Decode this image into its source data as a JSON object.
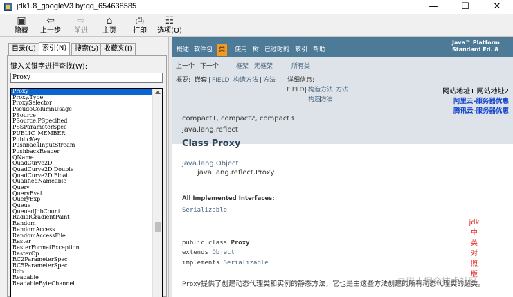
{
  "window": {
    "title": "jdk1.8_googleV3 by:qq_654638585",
    "minimize": "—",
    "maximize": "☐",
    "close": "✕"
  },
  "toolbar": {
    "items": [
      {
        "label": "隐藏",
        "icon": "hide-icon",
        "glyph": "▣",
        "enabled": true
      },
      {
        "label": "上一步",
        "icon": "back-arrow-icon",
        "glyph": "⇦",
        "enabled": true
      },
      {
        "label": "前进",
        "icon": "forward-arrow-icon",
        "glyph": "⇨",
        "enabled": false
      },
      {
        "label": "主页",
        "icon": "home-icon",
        "glyph": "⌂",
        "enabled": true
      },
      {
        "label": "打印",
        "icon": "print-icon",
        "glyph": "⎙",
        "enabled": true
      },
      {
        "label": "选项(O)",
        "icon": "options-icon",
        "glyph": "☷",
        "enabled": true
      }
    ]
  },
  "left": {
    "tabs": [
      "目录(C)",
      "索引(N)",
      "搜索(S)",
      "收藏夹(I)"
    ],
    "active_tab": 1,
    "keyword_label": "键入关键字进行查找(W):",
    "keyword_value": "Proxy",
    "list": [
      "Proxy",
      "Proxy.Type",
      "ProxySelector",
      "PseudoColumnUsage",
      "PSource",
      "PSource.PSpecified",
      "PSSParameterSpec",
      "PUBLIC_MEMBER",
      "PublicKey",
      "PushbackInputStream",
      "PushbackReader",
      "QName",
      "QuadCurve2D",
      "QuadCurve2D.Double",
      "QuadCurve2D.Float",
      "QualifiedNameable",
      "Query",
      "QueryEval",
      "QueryExp",
      "Queue",
      "QueuedJobCount",
      "RadialGradientPaint",
      "Random",
      "RandomAccess",
      "RandomAccessFile",
      "Raster",
      "RasterFormatException",
      "RasterOp",
      "RC2ParameterSpec",
      "RC5ParameterSpec",
      "Rdn",
      "Readable",
      "ReadableByteChannel"
    ],
    "selected_index": 0
  },
  "nav": {
    "items": [
      "概述",
      "软件包",
      "类",
      "使用",
      "树",
      "已过时的",
      "索引",
      "帮助"
    ],
    "active": 2,
    "platform_line1": "Java™ Platform",
    "platform_line2": "Standard Ed. 8"
  },
  "subnav": {
    "prev": "上一个",
    "next": "下一个",
    "frames": "框架",
    "no_frames": "无框架",
    "all_classes": "所有类",
    "summary_label": "概要:",
    "summary_nested": "嵌套",
    "summary_sep1": "|",
    "summary_field": "FIELD",
    "summary_sep2": "|",
    "summary_ctor": "构造方法",
    "summary_sep3": "|",
    "summary_method": "方法",
    "detail_label": "详细信息:",
    "detail_field": "FIELD",
    "detail_sep1": "|",
    "detail_ctor": "构造方法",
    "detail_sep2": "|",
    "detail_method": "方法",
    "ctor_wrap_1": "构造方",
    "ctor_wrap_2": "法",
    "method_wrap_1": "方",
    "method_wrap_2": "法"
  },
  "sitelinks": {
    "addresses": "网站地址1 网站地址2",
    "promo1": "阿里云-服务器优惠",
    "promo2": "腾讯云-服务器优惠"
  },
  "content": {
    "profiles": "compact1, compact2, compact3",
    "package": "java.lang.reflect",
    "title": "Class Proxy",
    "inherit_root": "java.lang.Object",
    "inherit_child": "java.lang.reflect.Proxy",
    "impl_label": "All Implemented Interfaces:",
    "impl_value": "Serializable",
    "decl_line1_kw": "public class ",
    "decl_line1_name": "Proxy",
    "decl_line2_kw": "extends ",
    "decl_line2_link": "Object",
    "decl_line3_kw": "implements ",
    "decl_line3_link": "Serializable",
    "desc_code": "Proxy",
    "desc_text": "提供了创建动态代理类和实例的静态方法，它也是由这些方法创建的所有动态代理类的超类。"
  },
  "side_note": [
    "jdk",
    "中",
    "英",
    "对",
    "照",
    "版"
  ],
  "watermark": "@稀土掘金技术社区"
}
